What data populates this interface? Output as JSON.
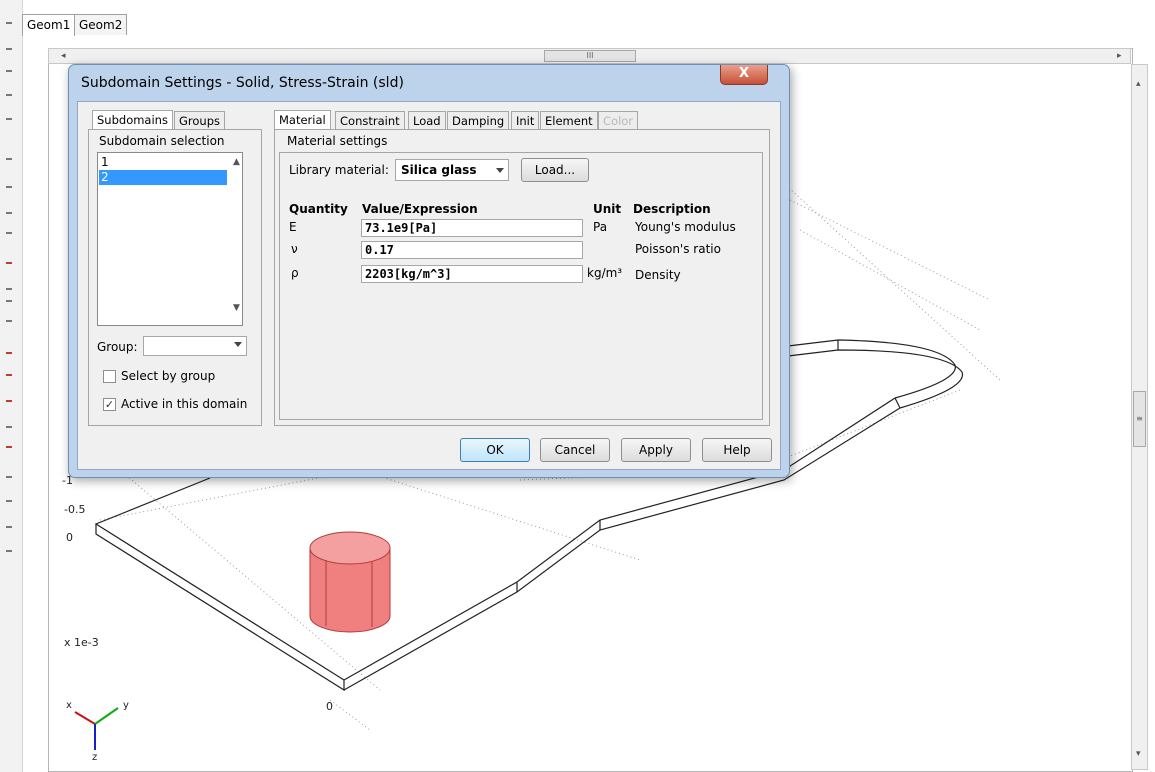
{
  "workspace": {
    "tabs": [
      "Geom1",
      "Geom2"
    ],
    "active_tab": "Geom1",
    "scrollbar_grip": "III",
    "axis_labels": {
      "z_minus1": "-1",
      "z_minus05": "-0.5",
      "z_0": "0",
      "scale": "x 1e-3",
      "x_0": "0"
    },
    "triad": {
      "x": "x",
      "y": "y",
      "z": "z"
    },
    "colors": {
      "solid": "#f08080",
      "edges": "#222222"
    }
  },
  "dialog": {
    "title": "Subdomain Settings - Solid, Stress-Strain (sld)",
    "close_label": "X",
    "left_tabs": [
      "Subdomains",
      "Groups"
    ],
    "subdomain_selection_label": "Subdomain selection",
    "subdomains": [
      "1",
      "2"
    ],
    "selected_subdomain": "2",
    "group_label": "Group:",
    "group_value": "",
    "select_by_group_label": "Select by group",
    "select_by_group_checked": false,
    "active_label": "Active in this domain",
    "active_checked": true,
    "right_tabs": [
      "Material",
      "Constraint",
      "Load",
      "Damping",
      "Init",
      "Element",
      "Color"
    ],
    "active_right_tab": "Material",
    "disabled_right_tab": "Color",
    "material_settings_label": "Material settings",
    "library_material_label": "Library material:",
    "library_material_value": "Silica glass",
    "load_button": "Load...",
    "table_headers": {
      "quantity": "Quantity",
      "value": "Value/Expression",
      "unit": "Unit",
      "description": "Description"
    },
    "rows": [
      {
        "quantity": "E",
        "value": "73.1e9[Pa]",
        "unit": "Pa",
        "description": "Young's modulus"
      },
      {
        "quantity": "ν",
        "value": "0.17",
        "unit": "",
        "description": "Poisson's ratio"
      },
      {
        "quantity": "ρ",
        "value": "2203[kg/m^3]",
        "unit": "kg/m³",
        "description": "Density"
      }
    ],
    "buttons": {
      "ok": "OK",
      "cancel": "Cancel",
      "apply": "Apply",
      "help": "Help"
    }
  }
}
